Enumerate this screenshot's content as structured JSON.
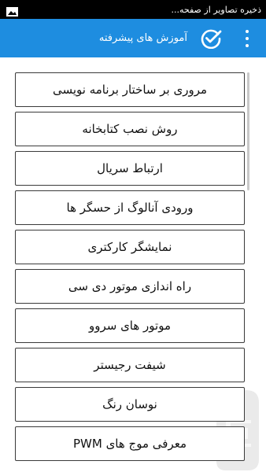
{
  "status_bar": {
    "notification_text": "ذخیره تصاویر از صفحه...",
    "notification_icon": "image-icon"
  },
  "app_bar": {
    "title": "آموزش های پیشرفته",
    "background_color": "#1e8de0",
    "icons": [
      "more-vert-icon",
      "check-circle-icon"
    ]
  },
  "menu": {
    "items": [
      {
        "label": "مروری بر ساختار برنامه نویسی"
      },
      {
        "label": "روش نصب کتابخانه"
      },
      {
        "label": "ارتباط سریال"
      },
      {
        "label": "ورودی آنالوگ از حسگر ها"
      },
      {
        "label": "نمایشگر کارکتری"
      },
      {
        "label": "راه اندازی موتور دی سی"
      },
      {
        "label": "موتور های سروو"
      },
      {
        "label": "شیفت رجیستر"
      },
      {
        "label": "نوسان رنگ"
      },
      {
        "label": "معرفی موج های PWM"
      }
    ]
  }
}
